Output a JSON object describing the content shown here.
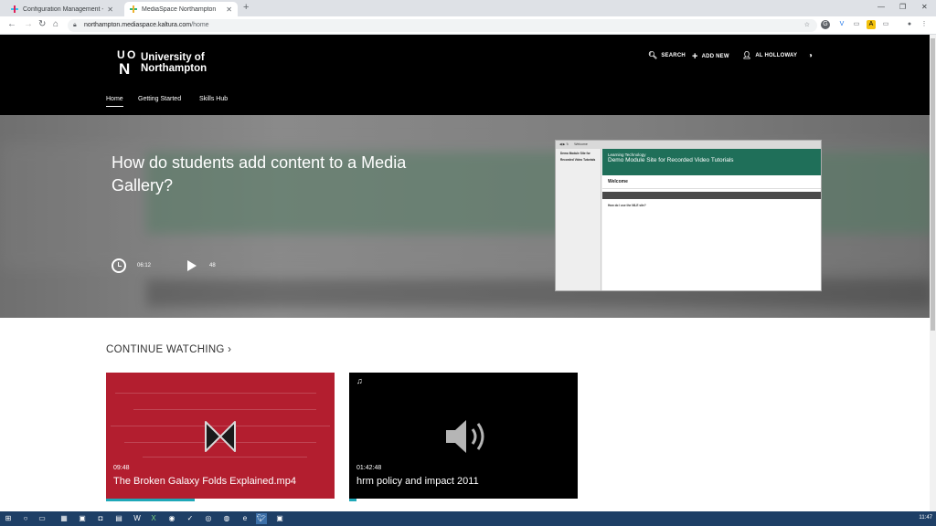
{
  "browser": {
    "tabs": [
      {
        "label": "Configuration Management - M"
      },
      {
        "label": "MediaSpace Northampton"
      }
    ],
    "url_host": "northampton.mediaspace.kaltura.com",
    "url_path": "/home"
  },
  "header": {
    "logo_mark": "UON",
    "logo_line1": "University of",
    "logo_line2": "Northampton",
    "search_label": "SEARCH",
    "add_new_label": "ADD NEW",
    "user_label": "AL HOLLOWAY"
  },
  "nav": {
    "items": [
      {
        "label": "Home"
      },
      {
        "label": "Getting Started"
      },
      {
        "label": "Skills Hub"
      }
    ]
  },
  "hero": {
    "title": "How do students add content to a Media Gallery?",
    "duration": "06:12",
    "plays": "48",
    "preview": {
      "topbar": "Welcome",
      "green_line1": "Learning Technology",
      "green_line2": "Demo Module Site for Recorded Video Tutorials",
      "welcome": "Welcome",
      "left_title": "Demo Module Site for Recorded Video Tutorials",
      "question": "How do I use the NILE site?"
    }
  },
  "continue": {
    "heading": "CONTINUE WATCHING ›",
    "cards": [
      {
        "duration": "09:48",
        "title": "The Broken Galaxy Folds Explained.mp4",
        "progress": 0.39
      },
      {
        "duration": "01:42:48",
        "title": "hrm policy and impact 2011",
        "progress": 0.03
      }
    ]
  },
  "taskbar": {
    "clock": "11:47"
  },
  "colors": {
    "accent": "#1fa8b8",
    "header_bg": "#000000",
    "card_red": "#b31e2f"
  }
}
